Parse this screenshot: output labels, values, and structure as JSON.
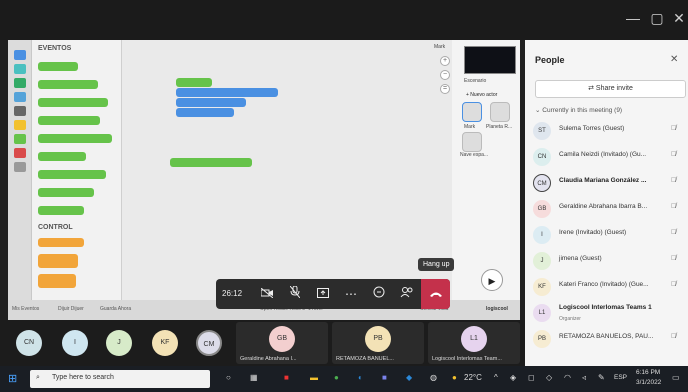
{
  "window": {
    "controls": [
      "—",
      "▢",
      "✕"
    ]
  },
  "shared_screen": {
    "palette_sections": [
      "EVENTOS",
      "CONTROL"
    ],
    "stage": {
      "sprite_name": "Mark",
      "stage_label": "Escenario",
      "sprites": [
        "Mark",
        "Planeta R...",
        "Nave espa..."
      ],
      "add_sprite": "+ Nuevo actor"
    },
    "bottom": {
      "tabs": [
        "Mis Eventos",
        "Dijuir Dijuer",
        "Guarda Ahora"
      ],
      "project": "Open House Rollo 3",
      "level": "1 nivel",
      "center": "Centrar vista",
      "brand": "logiscool"
    }
  },
  "call_controls": {
    "timer": "26:12",
    "hangup_tooltip": "Hang up",
    "icons": [
      "camera-off-icon",
      "mic-off-icon",
      "share-icon",
      "more-icon",
      "chat-icon",
      "people-icon",
      "hangup-icon"
    ]
  },
  "people_panel": {
    "title": "People",
    "share_invite": "Share invite",
    "section_label": "Currently in this meeting (9)",
    "people": [
      {
        "initials": "ST",
        "name": "Sulema Torres (Guest)",
        "bold": false,
        "color": "#dfe6ee"
      },
      {
        "initials": "CN",
        "name": "Camila Neizdi (Invitado) (Gu...",
        "bold": false,
        "color": "#dceeee"
      },
      {
        "initials": "CM",
        "name": "Claudia Mariana González ...",
        "bold": true,
        "color": "#e3e3ef"
      },
      {
        "initials": "GB",
        "name": "Geraldine Abrahana Ibarra B...",
        "bold": false,
        "color": "#f6dcdc"
      },
      {
        "initials": "I",
        "name": "Irene (Invitado) (Guest)",
        "bold": false,
        "color": "#dcecf3"
      },
      {
        "initials": "J",
        "name": "jimena (Guest)",
        "bold": false,
        "color": "#e2f0d8"
      },
      {
        "initials": "KF",
        "name": "Kateri Franco (Invitado) (Gue...",
        "bold": false,
        "color": "#f6ecd2"
      },
      {
        "initials": "L1",
        "name": "Logiscool Interlomas Teams 1",
        "role": "Organizer",
        "bold": true,
        "color": "#eadcf0"
      },
      {
        "initials": "PB",
        "name": "RETAMOZA BANUELOS, PAU...",
        "bold": false,
        "color": "#f6ecd2"
      }
    ]
  },
  "gallery": {
    "avatars": [
      {
        "initials": "CN",
        "color": "#cfe3e8"
      },
      {
        "initials": "I",
        "color": "#cfe6f0"
      },
      {
        "initials": "J",
        "color": "#d7ebc9"
      },
      {
        "initials": "KF",
        "color": "#f3e2b6"
      },
      {
        "initials": "CM",
        "color": "#dcdce9"
      }
    ],
    "tiles": [
      {
        "initials": "GB",
        "name": "Geraldine Abrahana I...",
        "color": "#f3cfcf"
      },
      {
        "initials": "PB",
        "name": "RETAMOZA BANUEL...",
        "color": "#f3e2b6"
      },
      {
        "initials": "L1",
        "name": "Logiscool Interlomas Team...",
        "color": "#e6d3ee"
      }
    ]
  },
  "taskbar": {
    "search_placeholder": "Type here to search",
    "weather": "22°C",
    "language": "ESP",
    "time": "6:16 PM",
    "date": "3/1/2022"
  }
}
